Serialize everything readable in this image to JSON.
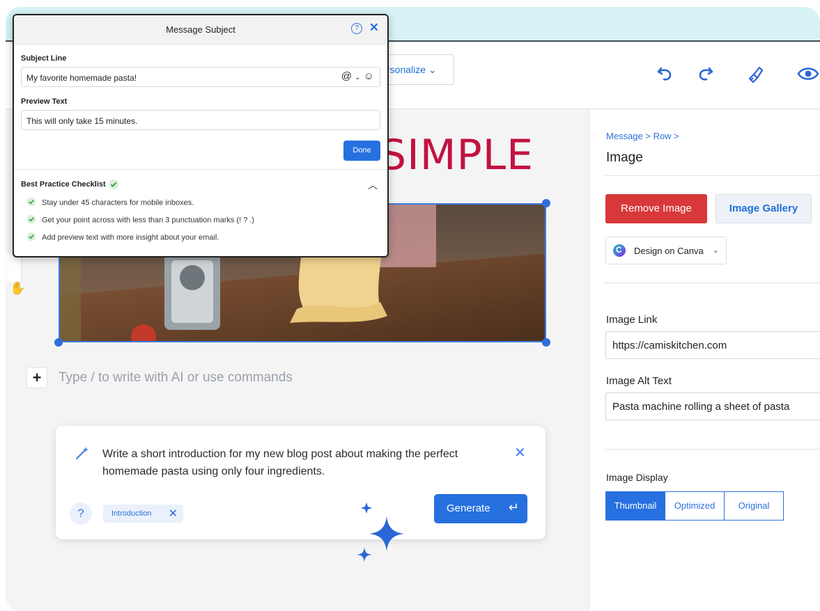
{
  "toolbar": {
    "personalize_label": "rsonalize ⌄",
    "icons": [
      "undo-icon",
      "redo-icon",
      "paint-brush-icon",
      "eye-icon"
    ]
  },
  "email": {
    "headline": "SIMPLE",
    "image_alt": "Pasta machine rolling a sheet of pasta",
    "type_hint": "Type / to write with AI or use commands"
  },
  "ai_prompt": {
    "text": "Write a short introduction for my new blog post about making the perfect homemade pasta using only four ingredients.",
    "help_label": "?",
    "chip_label": "Introduction",
    "generate_label": "Generate"
  },
  "modal": {
    "title": "Message Subject",
    "subject_label": "Subject Line",
    "subject_value": "My favorite homemade pasta!",
    "preview_label": "Preview Text",
    "preview_value": "This will only take 15 minutes.",
    "done_label": "Done",
    "checklist_title": "Best Practice Checklist",
    "checklist": [
      "Stay under 45 characters for mobile inboxes.",
      "Get your point across with less than 3 punctuation marks (! ? .)",
      "Add preview text with more insight about your email."
    ]
  },
  "panel": {
    "breadcrumb": "Message > Row >",
    "title": "Image",
    "remove_label": "Remove Image",
    "gallery_label": "Image Gallery",
    "canva_label": "Design on Canva",
    "link_label": "Image Link",
    "link_value": "https://camiskitchen.com",
    "alt_label": "Image Alt Text",
    "alt_value": "Pasta machine rolling a sheet of pasta",
    "display_label": "Image Display",
    "display_options": [
      "Thumbnail",
      "Optimized",
      "Original"
    ],
    "display_selected": "Thumbnail"
  },
  "colors": {
    "accent": "#2670e0",
    "danger": "#d8383a",
    "headline": "#c2123f",
    "top_band": "#d7f3f6"
  }
}
